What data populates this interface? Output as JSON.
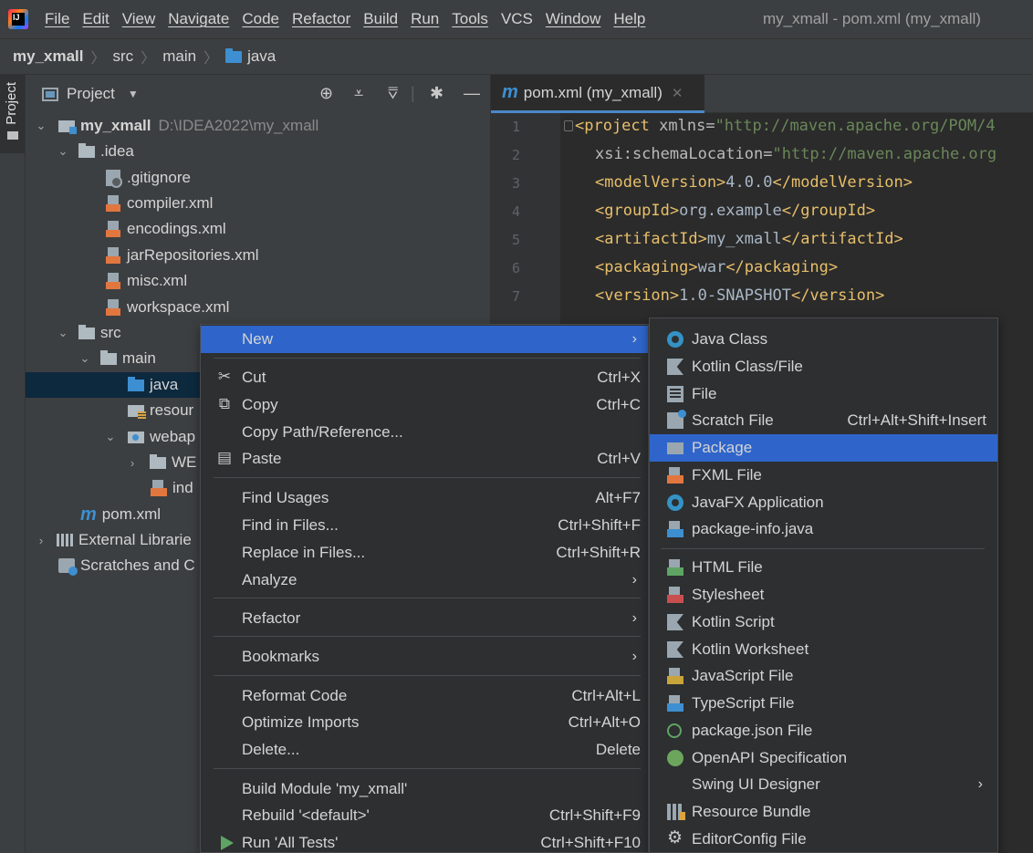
{
  "menubar": {
    "items": [
      "File",
      "Edit",
      "View",
      "Navigate",
      "Code",
      "Refactor",
      "Build",
      "Run",
      "Tools",
      "VCS",
      "Window",
      "Help"
    ],
    "window_title": "my_xmall - pom.xml (my_xmall)",
    "logo_text": "IJ"
  },
  "breadcrumb": [
    "my_xmall",
    "src",
    "main",
    "java"
  ],
  "toolstrip": {
    "project_label": "Project"
  },
  "project_panel": {
    "title": "Project",
    "tree": [
      {
        "name": "my_xmall",
        "path": "D:\\IDEA2022\\my_xmall"
      },
      {
        "name": ".idea"
      },
      {
        "name": ".gitignore"
      },
      {
        "name": "compiler.xml"
      },
      {
        "name": "encodings.xml"
      },
      {
        "name": "jarRepositories.xml"
      },
      {
        "name": "misc.xml"
      },
      {
        "name": "workspace.xml"
      },
      {
        "name": "src"
      },
      {
        "name": "main"
      },
      {
        "name": "java"
      },
      {
        "name": "resour"
      },
      {
        "name": "webap"
      },
      {
        "name": "WE"
      },
      {
        "name": "ind"
      },
      {
        "name": "pom.xml"
      },
      {
        "name": "External Librarie"
      },
      {
        "name": "Scratches and C"
      }
    ]
  },
  "editor": {
    "tab_label": "pom.xml (my_xmall)",
    "tab_icon": "m",
    "line_numbers": [
      "1",
      "2",
      "3",
      "4",
      "5",
      "6",
      "7"
    ],
    "lines": [
      {
        "tag_open": "<project ",
        "attr": "xmlns",
        "eq": "=",
        "val": "\"http://maven.apache.org/POM/4"
      },
      {
        "attr": "xsi:schemaLocation",
        "eq": "=",
        "val": "\"http://maven.apache.org"
      },
      {
        "open": "<modelVersion>",
        "text": "4.0.0",
        "close": "</modelVersion>"
      },
      {
        "open": "<groupId>",
        "text": "org.example",
        "close": "</groupId>"
      },
      {
        "open": "<artifactId>",
        "text": "my_xmall",
        "close": "</artifactId>"
      },
      {
        "open": "<packaging>",
        "text": "war",
        "close": "</packaging>"
      },
      {
        "open": "<version>",
        "text": "1.0-SNAPSHOT",
        "close": "</version>"
      }
    ]
  },
  "context_menu": {
    "new": {
      "label": "New"
    },
    "cut": {
      "label": "Cut",
      "shortcut": "Ctrl+X"
    },
    "copy": {
      "label": "Copy",
      "shortcut": "Ctrl+C"
    },
    "copy_path": {
      "label": "Copy Path/Reference..."
    },
    "paste": {
      "label": "Paste",
      "shortcut": "Ctrl+V"
    },
    "find_usages": {
      "label": "Find Usages",
      "shortcut": "Alt+F7"
    },
    "find_in_files": {
      "label": "Find in Files...",
      "shortcut": "Ctrl+Shift+F"
    },
    "replace_in_files": {
      "label": "Replace in Files...",
      "shortcut": "Ctrl+Shift+R"
    },
    "analyze": {
      "label": "Analyze"
    },
    "refactor": {
      "label": "Refactor"
    },
    "bookmarks": {
      "label": "Bookmarks"
    },
    "reformat_code": {
      "label": "Reformat Code",
      "shortcut": "Ctrl+Alt+L"
    },
    "optimize_imports": {
      "label": "Optimize Imports",
      "shortcut": "Ctrl+Alt+O"
    },
    "delete": {
      "label": "Delete...",
      "shortcut": "Delete"
    },
    "build_module": {
      "label": "Build Module 'my_xmall'"
    },
    "rebuild": {
      "label": "Rebuild '<default>'",
      "shortcut": "Ctrl+Shift+F9"
    },
    "run_tests": {
      "label": "Run 'All Tests'",
      "shortcut": "Ctrl+Shift+F10"
    }
  },
  "new_submenu": {
    "items": [
      {
        "label": "Java Class"
      },
      {
        "label": "Kotlin Class/File"
      },
      {
        "label": "File"
      },
      {
        "label": "Scratch File",
        "shortcut": "Ctrl+Alt+Shift+Insert"
      },
      {
        "label": "Package"
      },
      {
        "label": "FXML File"
      },
      {
        "label": "JavaFX Application"
      },
      {
        "label": "package-info.java"
      },
      {
        "label": "HTML File"
      },
      {
        "label": "Stylesheet"
      },
      {
        "label": "Kotlin Script"
      },
      {
        "label": "Kotlin Worksheet"
      },
      {
        "label": "JavaScript File"
      },
      {
        "label": "TypeScript File"
      },
      {
        "label": "package.json File"
      },
      {
        "label": "OpenAPI Specification"
      },
      {
        "label": "Swing UI Designer"
      },
      {
        "label": "Resource Bundle"
      },
      {
        "label": "EditorConfig File"
      }
    ]
  },
  "colors": {
    "selection": "#2f65ca",
    "tree_selection": "#0d293e",
    "accent": "#3d8fd1"
  }
}
